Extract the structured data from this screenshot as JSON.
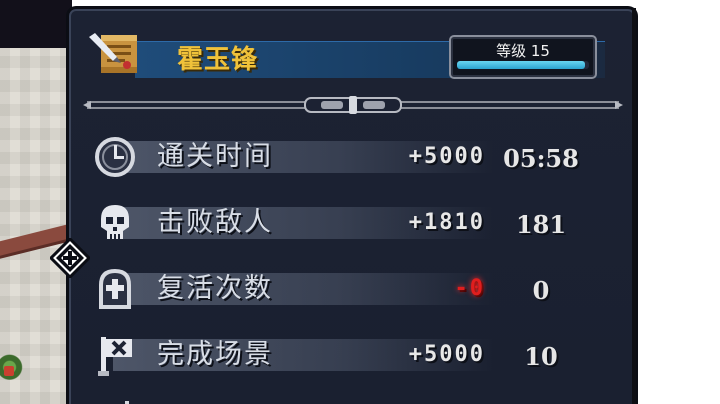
{
  "player": {
    "name": "霍玉锋",
    "level_label": "等级 15",
    "level_progress": 0.97
  },
  "stats": [
    {
      "label": "通关时间",
      "score": "+5000",
      "value": "05:58",
      "icon": "clock-icon",
      "negative": false
    },
    {
      "label": "击败敌人",
      "score": "+1810",
      "value": "181",
      "icon": "skull-icon",
      "negative": false
    },
    {
      "label": "复活次数",
      "score": "-0",
      "value": "0",
      "icon": "tombstone-icon",
      "negative": true
    },
    {
      "label": "完成场景",
      "score": "+5000",
      "value": "10",
      "icon": "flag-icon",
      "negative": false
    }
  ],
  "colors": {
    "panel_bg": "#1c2233",
    "name_gold": "#f0c23a",
    "level_bar": "#2ba3cf",
    "negative_red": "#e01e1e"
  }
}
